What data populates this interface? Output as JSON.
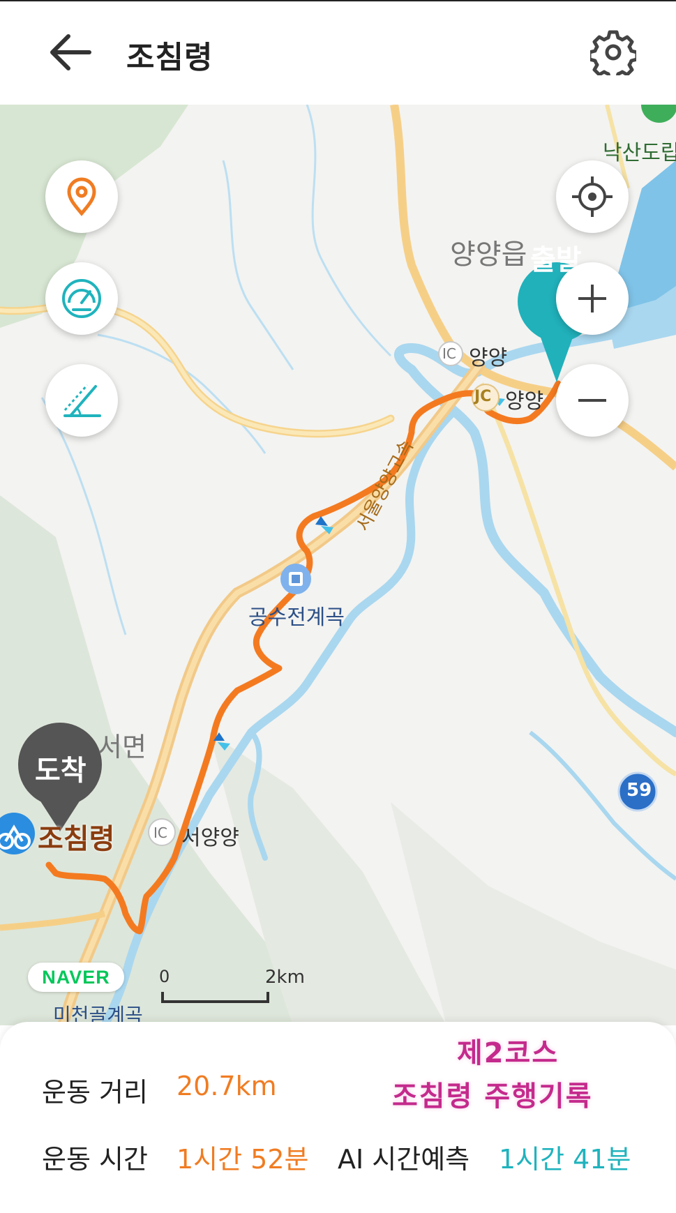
{
  "header": {
    "back_icon": "arrow-left-icon",
    "title": "조침령",
    "settings_icon": "gear-icon"
  },
  "map_controls": {
    "left": [
      "location-pin-icon",
      "speedometer-icon",
      "slope-icon"
    ],
    "right": [
      "current-location-icon",
      "zoom-in-icon",
      "zoom-out-icon"
    ]
  },
  "map": {
    "start_marker": "출발",
    "end_marker": "도착",
    "place_labels": {
      "nakSanDoRip": "낙산도립",
      "yangyangEup": "양양읍",
      "ic_yangyang": "양양",
      "jc_yangyang": "양양",
      "highway": "서울양양고속",
      "gongsu": "공수전계곡",
      "seomyeon": "서면",
      "destination": "조침령",
      "ic_seoyangyang": "서양양",
      "micheon": "미천골계곡"
    },
    "ic_badge": "IC",
    "jc_badge": "JC",
    "route_badge": "59",
    "brand": "NAVER",
    "scale_zero": "0",
    "scale_end": "2km",
    "colors": {
      "route": "#f47a20",
      "river": "#a9d7ef",
      "road": "#f6d48c",
      "teal": "#20b1bb"
    }
  },
  "summary": {
    "distance_label": "운동 거리",
    "distance_value": "20.7km",
    "time_label": "운동 시간",
    "time_value": "1시간 52분",
    "ai_label": "AI 시간예측",
    "ai_value": "1시간 41분",
    "overlay_line1": "제2코스",
    "overlay_line2": "조침령 주행기록"
  }
}
